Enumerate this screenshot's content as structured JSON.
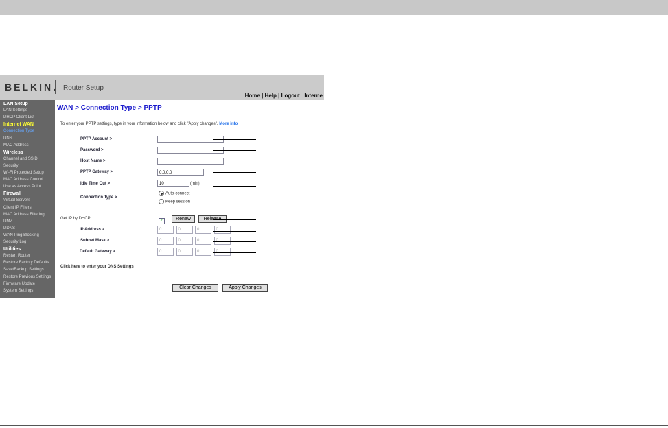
{
  "header": {
    "logo": "BELKIN.",
    "app_title": "Router Setup",
    "links": "Home | Help | Logout   Interne"
  },
  "sidebar": [
    {
      "label": "LAN Setup",
      "type": "h"
    },
    {
      "label": "LAN Settings"
    },
    {
      "label": "DHCP Client List"
    },
    {
      "label": "Internet WAN",
      "type": "y"
    },
    {
      "label": "Connection Type",
      "type": "a"
    },
    {
      "label": "DNS"
    },
    {
      "label": "MAC Address"
    },
    {
      "label": "Wireless",
      "type": "h"
    },
    {
      "label": "Channel and SSID"
    },
    {
      "label": "Security"
    },
    {
      "label": "Wi-Fi Protected Setup"
    },
    {
      "label": "MAC Address Control"
    },
    {
      "label": "Use as Access Point"
    },
    {
      "label": "Firewall",
      "type": "h"
    },
    {
      "label": "Virtual Servers"
    },
    {
      "label": "Client IP Filters"
    },
    {
      "label": "MAC Address Filtering"
    },
    {
      "label": "DMZ"
    },
    {
      "label": "DDNS"
    },
    {
      "label": "WAN Ping Blocking"
    },
    {
      "label": "Security Log"
    },
    {
      "label": "Utilities",
      "type": "h"
    },
    {
      "label": "Restart Router"
    },
    {
      "label": "Restore Factory Defaults"
    },
    {
      "label": "Save/Backup Settings"
    },
    {
      "label": "Restore Previous Settings"
    },
    {
      "label": "Firmware Update"
    },
    {
      "label": "System Settings"
    }
  ],
  "main": {
    "title": "WAN > Connection Type > PPTP",
    "intro": "To enter your PPTP settings, type in your information below and click \"Apply changes\". ",
    "more_info": "More info",
    "pptp_account_label": "PPTP Account >",
    "pptp_account": "",
    "password_label": "Password >",
    "password": "",
    "host_name_label": "Host Name >",
    "host_name": "",
    "gateway_label": "PPTP Gateway >",
    "gateway": "0.0.0.0",
    "idle_label": "Idle Time Out >",
    "idle": "10",
    "idle_unit": "(min)",
    "conn_type_label": "Connection Type >",
    "opt_auto": "Auto-connect",
    "opt_keep": "Keep session",
    "dhcp_label": "Get IP by DHCP",
    "dhcp_checked": true,
    "renew": "Renew",
    "release": "Release",
    "ip_label": "IP Address >",
    "subnet_label": "Subnet Mask >",
    "dgw_label": "Default Gateway >",
    "octet": "0",
    "dns_link": "Click here to enter your DNS Settings",
    "clear": "Clear Changes",
    "apply": "Apply Changes"
  }
}
